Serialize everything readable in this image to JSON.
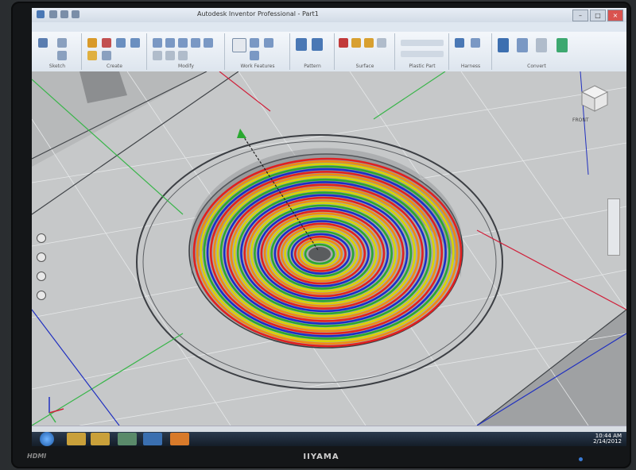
{
  "window": {
    "title": "Autodesk Inventor Professional - Part1"
  },
  "window_controls": {
    "minimize": "–",
    "maximize": "□",
    "close": "×"
  },
  "ribbon_panels": [
    {
      "label": "Sketch"
    },
    {
      "label": "Create"
    },
    {
      "label": "Modify"
    },
    {
      "label": "Work Features"
    },
    {
      "label": "Pattern"
    },
    {
      "label": "Surface"
    },
    {
      "label": "Plastic Part"
    },
    {
      "label": "Harness"
    },
    {
      "label": "Convert"
    }
  ],
  "viewcube": {
    "label": "FRONT"
  },
  "taskbar": {
    "time": "10:44 AM",
    "date": "2/14/2012"
  },
  "monitor": {
    "brand": "IIYAMA",
    "badge": "HDMI"
  },
  "colors": {
    "coil_red": "#e02020",
    "coil_orange": "#f08a10",
    "coil_yellow": "#d8d400",
    "coil_green": "#2aa830",
    "coil_blue": "#1a2ec8",
    "axis_green": "#39b54a",
    "axis_red": "#d0203a",
    "axis_blue": "#2030c0"
  }
}
